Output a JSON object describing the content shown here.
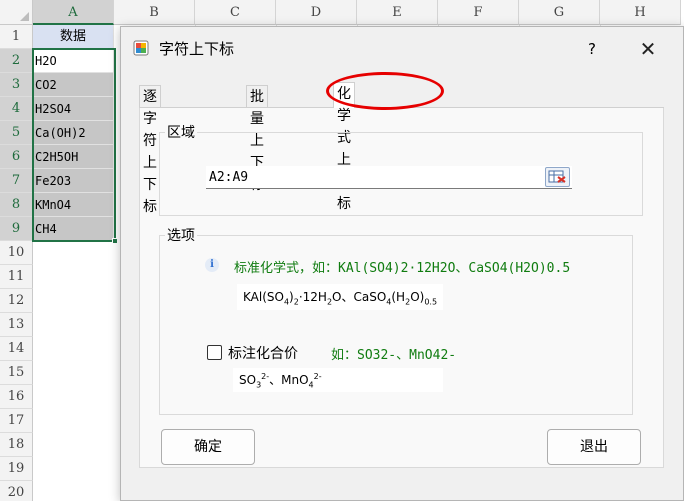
{
  "sheet": {
    "columns": [
      "A",
      "B",
      "C",
      "D",
      "E",
      "F",
      "G",
      "H"
    ],
    "rows": [
      "1",
      "2",
      "3",
      "4",
      "5",
      "6",
      "7",
      "8",
      "9",
      "10",
      "11",
      "12",
      "13",
      "14",
      "15",
      "16",
      "17",
      "18",
      "19",
      "20"
    ],
    "header_cell": "数据",
    "cells": [
      "H2O",
      "CO2",
      "H2SO4",
      "Ca(OH)2",
      "C2H5OH",
      "Fe2O3",
      "KMnO4",
      "CH4"
    ]
  },
  "dialog": {
    "title": "字符上下标",
    "help": "?",
    "close": "✕",
    "tabs": [
      "逐字符上下标",
      "批量上下标",
      "化学式上下标"
    ],
    "active_tab": 2,
    "region": {
      "label": "区域",
      "value": "A2:A9"
    },
    "options": {
      "label": "选项",
      "standard_label": "标准化学式，如：KAl(SO4)2·12H2O、CaSO4(H2O)0.5",
      "standard_preview": {
        "p1": "KAl(SO",
        "s1": "4",
        "p2": ")",
        "s2": "2",
        "p3": "·12H",
        "s3": "2",
        "p4": "O、CaSO",
        "s4": "4",
        "p5": "(H",
        "s5": "2",
        "p6": "O)",
        "s6": "0.5"
      },
      "valence_label": "标注化合价",
      "valence_checked": false,
      "valence_example": "如：SO32-、MnO42-",
      "valence_preview": {
        "p1": "SO",
        "b1": "3",
        "u1": "2-",
        "p2": "、MnO",
        "b2": "4",
        "u2": "2-"
      }
    },
    "ok_label": "确定",
    "exit_label": "退出"
  },
  "colors": {
    "accent_green": "#217346",
    "example_text": "#107c10",
    "highlight_ring": "#e60000"
  },
  "icons": {
    "app": "app-window-icon",
    "info": "info-icon",
    "range_select": "range-select-icon"
  }
}
